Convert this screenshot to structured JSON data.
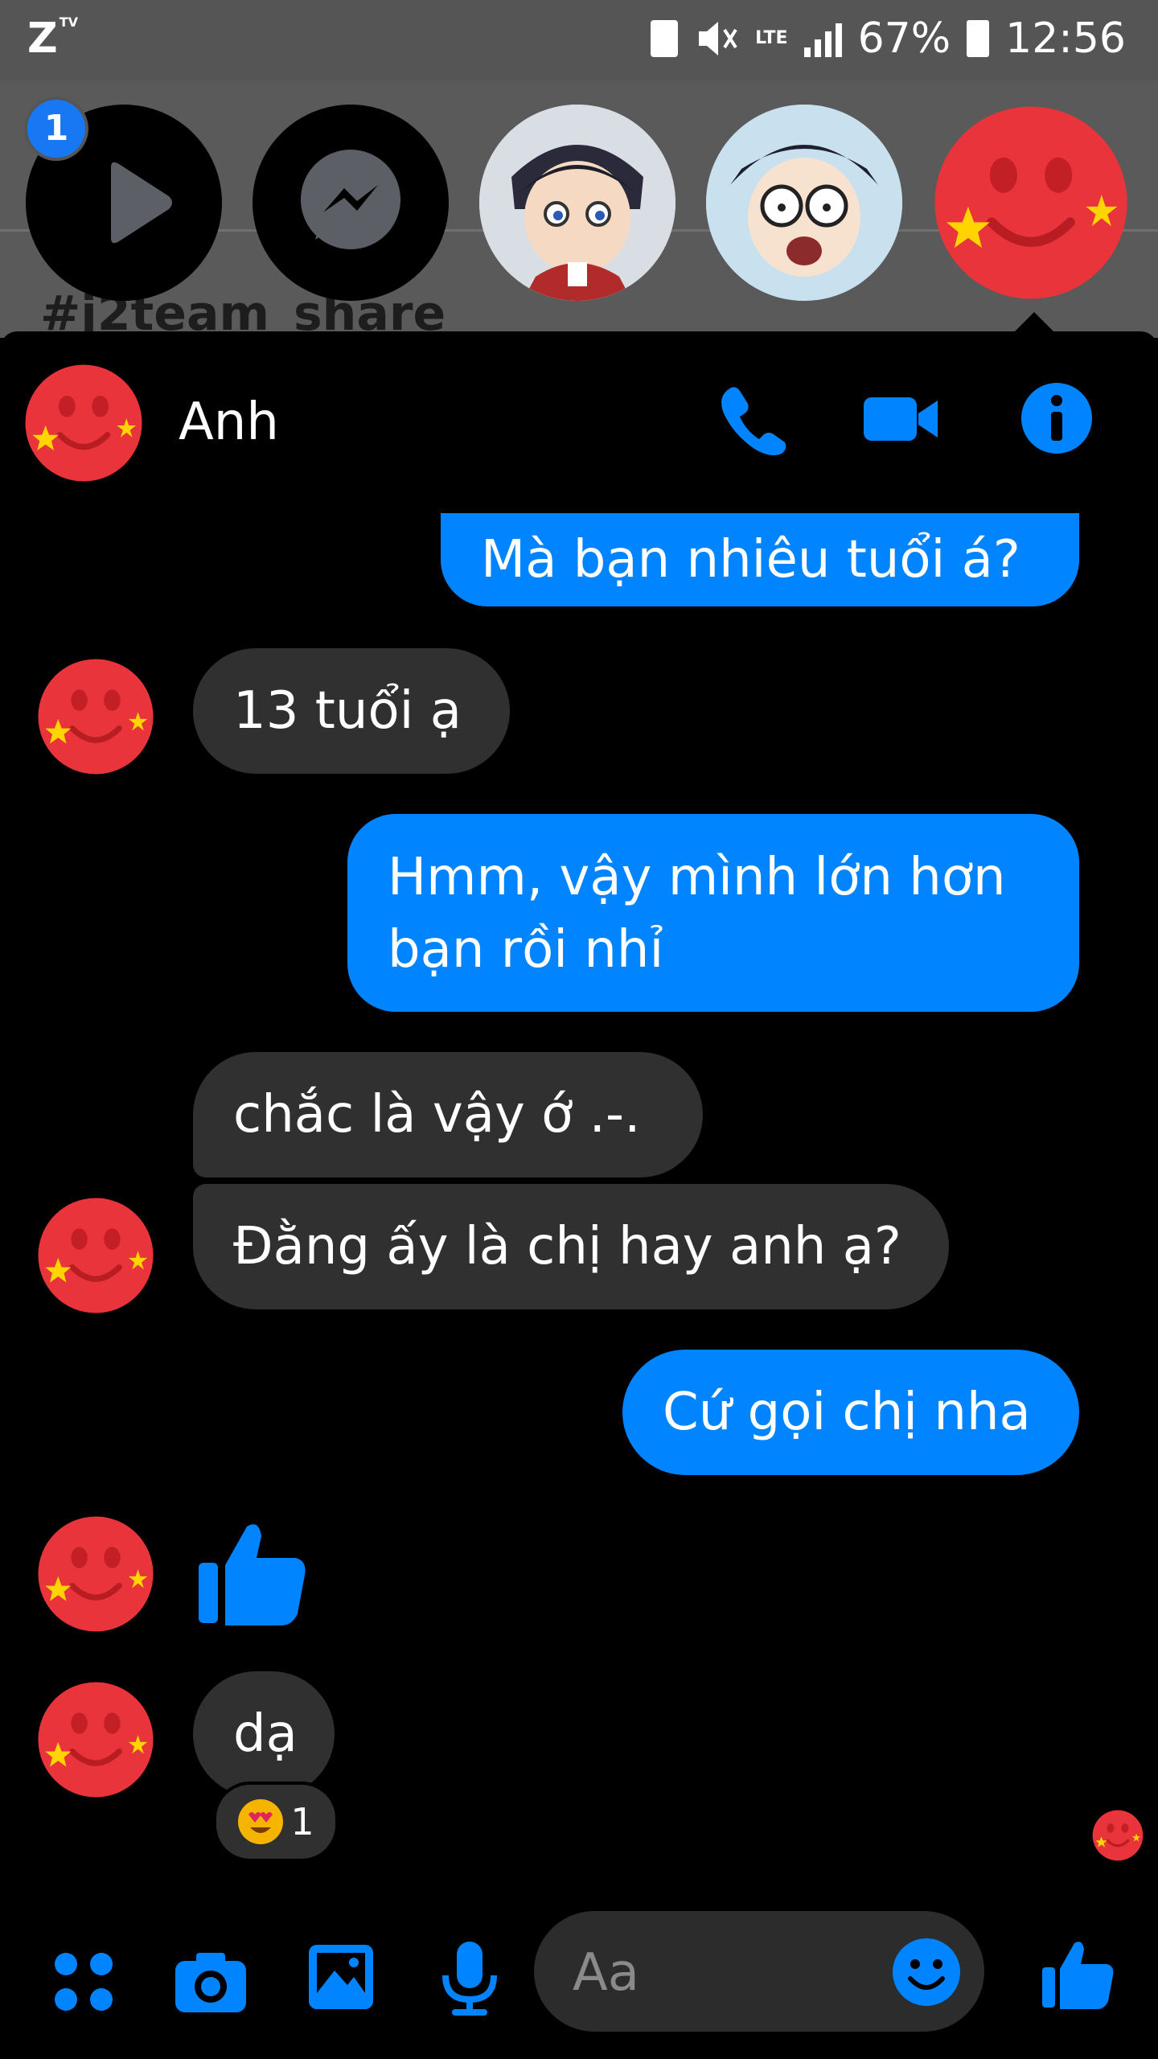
{
  "status_bar": {
    "carrier_logo": "Z",
    "carrier_sub": "TV",
    "network": "LTE",
    "battery": "67%",
    "time": "12:56"
  },
  "background_app": {
    "hashtag_text": "#j2team_share"
  },
  "chat_heads": {
    "badge_count": "1",
    "items": [
      {
        "icon": "play-icon"
      },
      {
        "icon": "messenger-icon"
      },
      {
        "icon": "anime-avatar-1"
      },
      {
        "icon": "anime-avatar-2"
      },
      {
        "icon": "smiley-star-avatar"
      }
    ]
  },
  "conversation": {
    "contact_name": "Anh",
    "header_icons": [
      "phone-icon",
      "video-icon",
      "info-icon"
    ],
    "messages": [
      {
        "from": "me",
        "text": "Mà bạn nhiêu tuổi á?"
      },
      {
        "from": "them",
        "text": "13 tuổi ạ"
      },
      {
        "from": "me",
        "text": "Hmm, vậy mình lớn hơn\nbạn rồi nhỉ"
      },
      {
        "from": "them",
        "text": "chắc là vậy ớ .-."
      },
      {
        "from": "them",
        "text": "Đằng ấy là chị hay anh ạ?"
      },
      {
        "from": "me",
        "text": "Cứ gọi chị nha"
      },
      {
        "from": "them",
        "type": "like",
        "icon": "thumbs-up-icon"
      },
      {
        "from": "them",
        "text": "dạ"
      }
    ],
    "reaction": {
      "emoji": "heart-eyes",
      "count": "1"
    }
  },
  "composer": {
    "placeholder": "Aa",
    "buttons": [
      "apps-icon",
      "camera-icon",
      "gallery-icon",
      "mic-icon",
      "emoji-icon",
      "thumbs-up-icon"
    ]
  },
  "colors": {
    "accent": "#0084ff",
    "bubble_them": "#303030",
    "avatar_red": "#e8343a",
    "star_yellow": "#ffd400"
  }
}
